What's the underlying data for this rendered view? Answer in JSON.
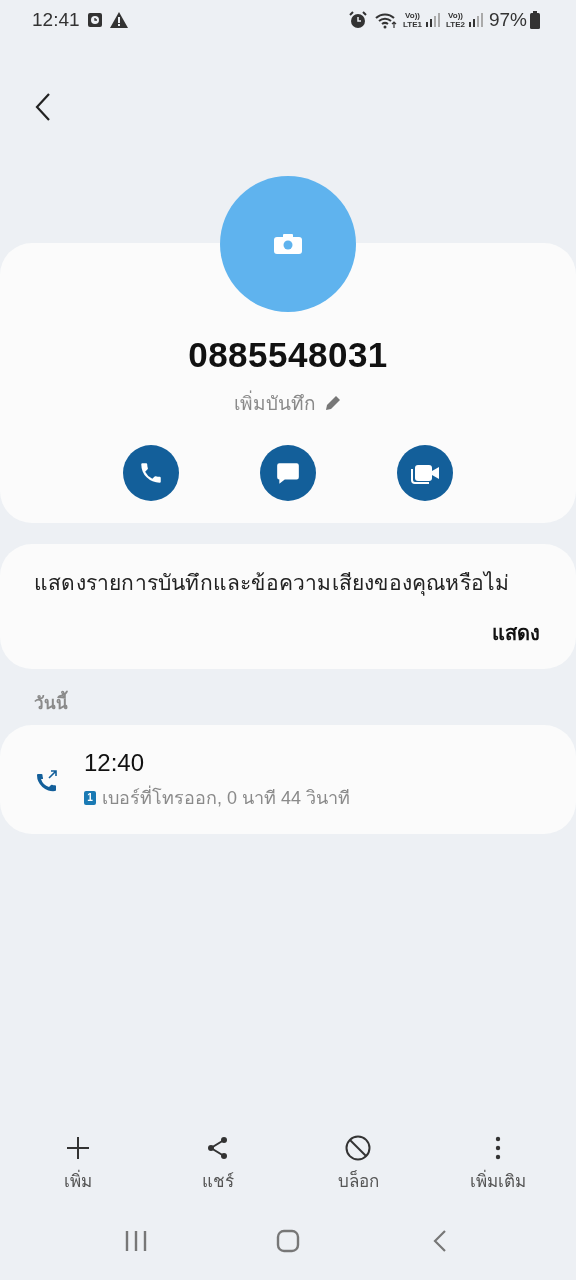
{
  "status_bar": {
    "time": "12:41",
    "sims": [
      {
        "top": "Vo))",
        "bottom": "LTE1"
      },
      {
        "top": "Vo))",
        "bottom": "LTE2"
      }
    ],
    "battery": "97%"
  },
  "contact": {
    "number": "0885548031",
    "note_label": "เพิ่มบันทึก"
  },
  "prompt": {
    "text": "แสดงรายการบันทึกและข้อความเสียงของคุณหรือไม่",
    "action": "แสดง"
  },
  "call_log": {
    "section": "วันนี้",
    "entries": [
      {
        "time": "12:40",
        "sim": "1",
        "detail": "เบอร์ที่โทรออก, 0 นาที 44 วินาที"
      }
    ]
  },
  "toolbar": [
    {
      "kind": "add",
      "label": "เพิ่ม"
    },
    {
      "kind": "share",
      "label": "แชร์"
    },
    {
      "kind": "block",
      "label": "บล็อก"
    },
    {
      "kind": "more",
      "label": "เพิ่มเติม"
    }
  ]
}
